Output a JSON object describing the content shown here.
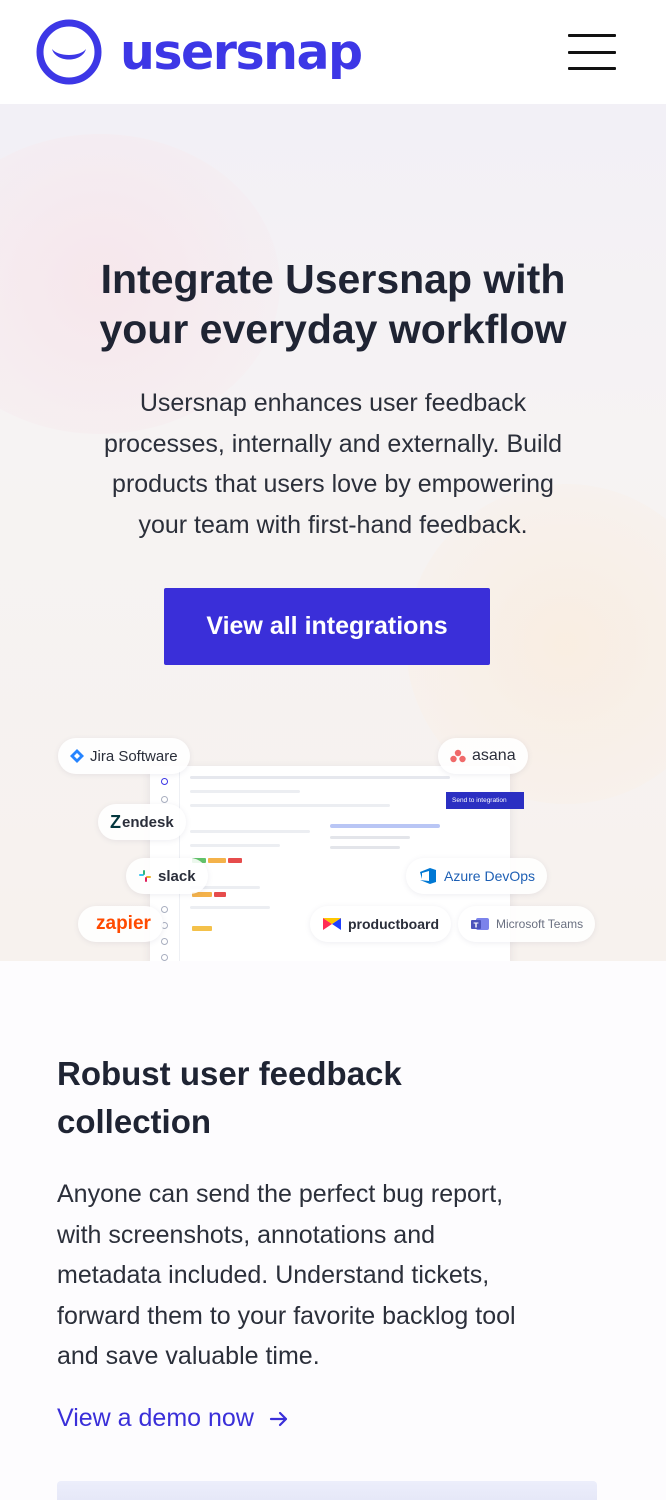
{
  "header": {
    "logo_text": "usersnap",
    "brand_color": "#3d37e6",
    "menu_icon": "hamburger-menu-icon"
  },
  "hero": {
    "title_line1": "Integrate Usersnap with",
    "title_line2": "your everyday workflow",
    "description_lines": [
      "Usersnap enhances user feedback",
      "processes, internally and externally. Build",
      "products that users love by empowering",
      "your team with first-hand feedback."
    ],
    "cta_label": "View all integrations",
    "cta_color": "#3a2fd9",
    "mock_button_label": "Send to integration",
    "integrations": [
      {
        "label": "Jira Software",
        "icon": "jira-icon"
      },
      {
        "label": "asana",
        "icon": "asana-icon"
      },
      {
        "label": "endesk",
        "icon": "zendesk-icon"
      },
      {
        "label": "slack",
        "icon": "slack-icon"
      },
      {
        "label": "Azure DevOps",
        "icon": "azure-devops-icon"
      },
      {
        "label": "zapier",
        "icon": "zapier-icon"
      },
      {
        "label": "productboard",
        "icon": "productboard-icon"
      },
      {
        "label": "Microsoft Teams",
        "icon": "microsoft-teams-icon"
      }
    ]
  },
  "feature": {
    "title_line1": "Robust user feedback",
    "title_line2": "collection",
    "description_lines": [
      "Anyone can send the perfect bug report,",
      "with screenshots, annotations and",
      "metadata included. Understand tickets,",
      "forward them to your favorite backlog tool",
      "and save valuable time."
    ],
    "link_label": "View a demo now",
    "link_icon": "arrow-right-icon"
  }
}
